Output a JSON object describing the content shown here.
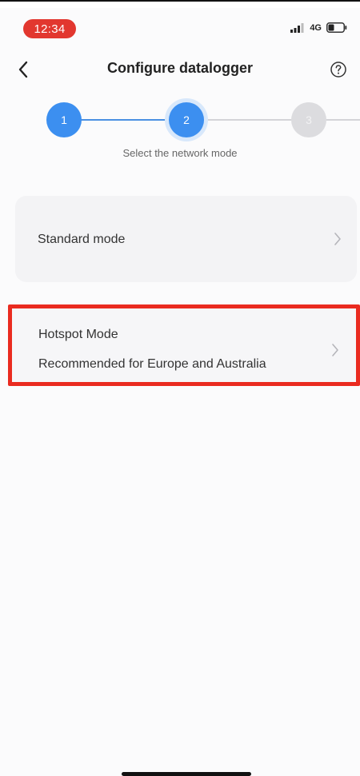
{
  "status_bar": {
    "time": "12:34",
    "network": "4G",
    "icons": [
      "signal-icon",
      "battery-icon"
    ]
  },
  "header": {
    "title": "Configure datalogger",
    "back_icon": "chevron-left-icon",
    "help_icon": "question-circle-icon"
  },
  "stepper": {
    "steps": [
      {
        "label": "1",
        "state": "completed"
      },
      {
        "label": "2",
        "state": "active"
      },
      {
        "label": "3",
        "state": "pending"
      }
    ],
    "caption": "Select the network mode"
  },
  "modes": [
    {
      "title": "Standard mode",
      "subtitle": ""
    },
    {
      "title": "Hotspot Mode",
      "subtitle": "Recommended for Europe and Australia"
    }
  ],
  "colors": {
    "accent": "#3c8ff0",
    "highlight": "#ea2b20",
    "time_pill": "#e2372f"
  }
}
